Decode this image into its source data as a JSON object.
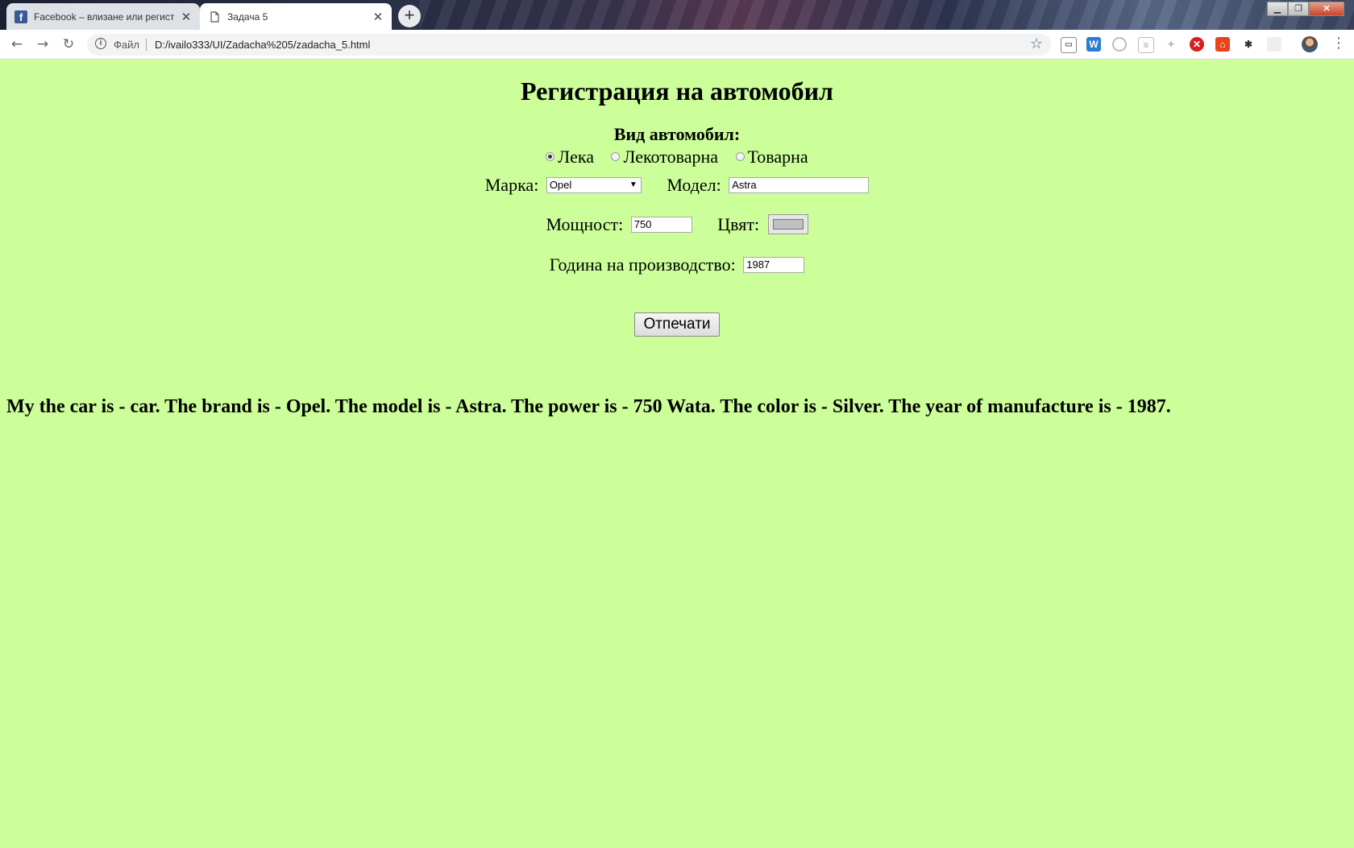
{
  "browser": {
    "tabs": [
      {
        "label": "Facebook – влизане или регист",
        "favicon": "facebook-icon",
        "active": false
      },
      {
        "label": "Задача 5",
        "favicon": "page-icon",
        "active": true
      }
    ],
    "address": {
      "scheme": "Файл",
      "url": "D:/ivailo333/UI/Zadacha%205/zadacha_5.html"
    },
    "extensions": [
      "cast-icon",
      "word-icon",
      "circle-icon",
      "note-icon",
      "puzzle-icon",
      "block-icon",
      "lock-icon",
      "bug-icon",
      "blank-icon"
    ]
  },
  "form": {
    "heading": "Регистрация на автомобил",
    "vehicle_type_label": "Вид автомобил:",
    "vehicle_types": [
      {
        "label": "Лека",
        "checked": true
      },
      {
        "label": "Лекотоварна",
        "checked": false
      },
      {
        "label": "Товарна",
        "checked": false
      }
    ],
    "brand_label": "Марка:",
    "brand_value": "Opel",
    "model_label": "Модел:",
    "model_value": "Astra",
    "power_label": "Мощност:",
    "power_value": "750",
    "color_label": "Цвят:",
    "color_value": "#c0c0c0",
    "year_label": "Година на производство:",
    "year_value": "1987",
    "print_button": "Отпечати"
  },
  "result": "My the car is - car. The brand is - Opel. The model is - Astra. The power is - 750 Wata. The color is - Silver. The year of manufacture is - 1987.",
  "colors": {
    "page_background": "#ccff99"
  }
}
